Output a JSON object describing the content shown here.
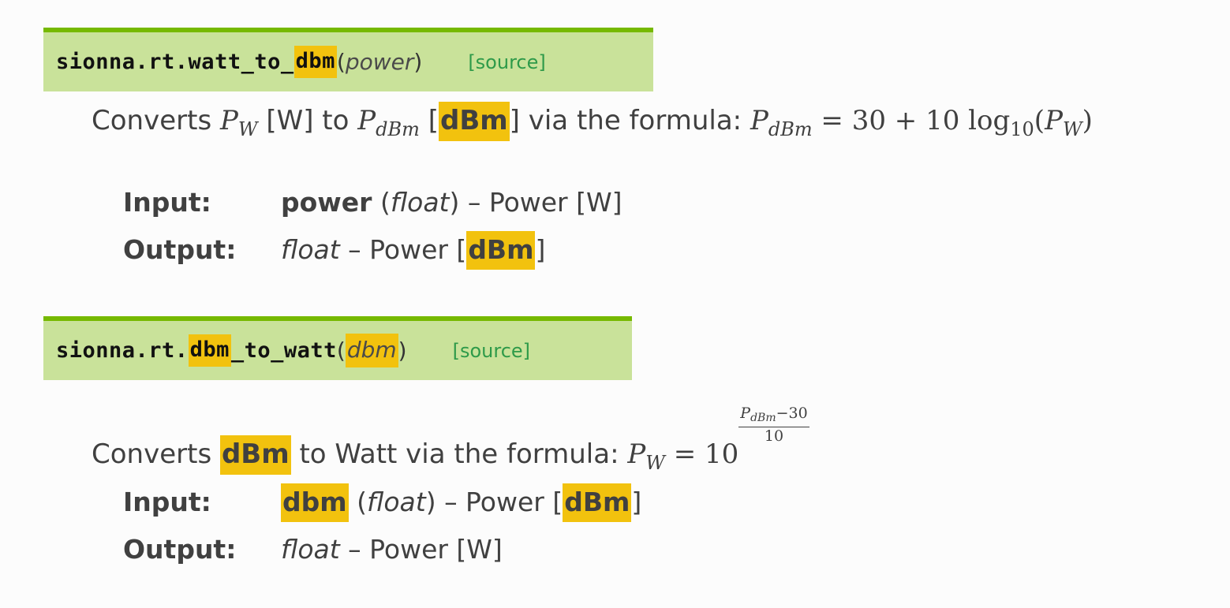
{
  "block1": {
    "sig_prefix": "sionna.rt.watt_to_",
    "sig_highlight": "dbm",
    "param": "power",
    "source": "[source]",
    "desc": {
      "converts": "Converts",
      "pw_main": "P",
      "pw_sub": "W",
      "w_unit": "[W] to",
      "pdbm_main": "P",
      "pdbm_sub": "dBm",
      "bracket_open": "[",
      "dbm_unit": "dBm",
      "via": "] via the formula:",
      "formula_lhs_main": "P",
      "formula_lhs_sub": "dBm",
      "formula_mid": "= 30 + 10 log",
      "formula_log_sub": "10",
      "formula_open": "(",
      "formula_arg_main": "P",
      "formula_arg_sub": "W",
      "formula_close": ")"
    },
    "fields": {
      "input_label": "Input:",
      "input_name": "power",
      "input_type_open": "(",
      "input_type": "float",
      "input_type_close": ")",
      "input_desc": "– Power [W]",
      "output_label": "Output:",
      "output_type": "float",
      "output_desc": "– Power [",
      "output_unit": "dBm",
      "output_close": "]"
    }
  },
  "block2": {
    "sig_prefix": "sionna.rt.",
    "sig_highlight": "dbm",
    "sig_suffix": "_to_watt",
    "param": "dbm",
    "source": "[source]",
    "desc": {
      "converts": "Converts",
      "dbm_hl": "dBm",
      "via": "to Watt via the formula:",
      "lhs_main": "P",
      "lhs_sub": "W",
      "eq": "= 10",
      "exp_num_main": "P",
      "exp_num_sub": "dBm",
      "exp_num_rest": "−30",
      "exp_den": "10"
    },
    "fields": {
      "input_label": "Input:",
      "input_name": "dbm",
      "input_type_open": "(",
      "input_type": "float",
      "input_type_close": ")",
      "input_desc": "– Power [",
      "input_unit": "dBm",
      "input_close": "]",
      "output_label": "Output:",
      "output_type": "float",
      "output_desc": "– Power [W]"
    }
  },
  "colors": {
    "signature_bg": "#c9e29a",
    "signature_border": "#76b900",
    "highlight": "#f2c20e",
    "source_link": "#2e9a49"
  }
}
